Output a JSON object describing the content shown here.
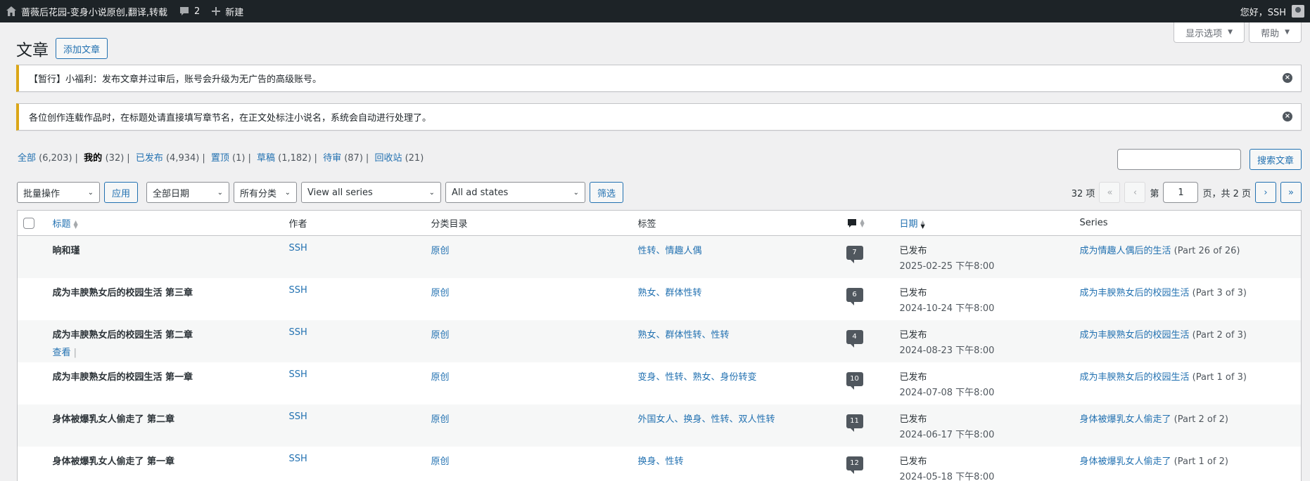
{
  "adminbar": {
    "site_title": "蔷薇后花园-变身小说原创,翻译,转载",
    "comments_count": "2",
    "new_label": "新建",
    "greeting": "您好，SSH"
  },
  "screen_meta": {
    "options_label": "显示选项",
    "help_label": "帮助"
  },
  "page": {
    "title": "文章",
    "add_new_label": "添加文章"
  },
  "notices": [
    "【暂行】小福利：发布文章并过审后，账号会升级为无广告的高级账号。",
    "各位创作连载作品时，在标题处请直接填写章节名，在正文处标注小说名，系统会自动进行处理了。"
  ],
  "views": [
    {
      "label": "全部",
      "count": "(6,203)"
    },
    {
      "label": "我的",
      "count": "(32)"
    },
    {
      "label": "已发布",
      "count": "(4,934)"
    },
    {
      "label": "置顶",
      "count": "(1)"
    },
    {
      "label": "草稿",
      "count": "(1,182)"
    },
    {
      "label": "待审",
      "count": "(87)"
    },
    {
      "label": "回收站",
      "count": "(21)"
    }
  ],
  "search": {
    "button_label": "搜索文章",
    "value": ""
  },
  "filters": {
    "bulk_action": "批量操作",
    "apply_label": "应用",
    "date": "全部日期",
    "category": "所有分类",
    "series": "View all series",
    "ad_state": "All ad states",
    "filter_label": "筛选"
  },
  "pagination": {
    "items": "32 项",
    "first": "«",
    "prev": "‹",
    "page_prefix": "第",
    "current": "1",
    "page_suffix": "页，共 2 页",
    "next": "›",
    "last": "»"
  },
  "columns": {
    "title": "标题",
    "author": "作者",
    "categories": "分类目录",
    "tags": "标签",
    "date": "日期",
    "series": "Series"
  },
  "rows": [
    {
      "title": "晌和瑾",
      "author": "SSH",
      "category": "原创",
      "tags": "性转、情趣人偶",
      "comments": "7",
      "status": "已发布",
      "date": "2025-02-25 下午8:00",
      "series_link": "成为情趣人偶后的生活",
      "series_part": "(Part 26 of 26)",
      "action": ""
    },
    {
      "title": "成为丰腴熟女后的校园生活 第三章",
      "author": "SSH",
      "category": "原创",
      "tags": "熟女、群体性转",
      "comments": "6",
      "status": "已发布",
      "date": "2024-10-24 下午8:00",
      "series_link": "成为丰腴熟女后的校园生活",
      "series_part": "(Part 3 of 3)",
      "action": ""
    },
    {
      "title": "成为丰腴熟女后的校园生活 第二章",
      "author": "SSH",
      "category": "原创",
      "tags": "熟女、群体性转、性转",
      "comments": "4",
      "status": "已发布",
      "date": "2024-08-23 下午8:00",
      "series_link": "成为丰腴熟女后的校园生活",
      "series_part": "(Part 2 of 3)",
      "action": "查看"
    },
    {
      "title": "成为丰腴熟女后的校园生活 第一章",
      "author": "SSH",
      "category": "原创",
      "tags": "变身、性转、熟女、身份转变",
      "comments": "10",
      "status": "已发布",
      "date": "2024-07-08 下午8:00",
      "series_link": "成为丰腴熟女后的校园生活",
      "series_part": "(Part 1 of 3)",
      "action": ""
    },
    {
      "title": "身体被爆乳女人偷走了 第二章",
      "author": "SSH",
      "category": "原创",
      "tags": "外国女人、换身、性转、双人性转",
      "comments": "11",
      "status": "已发布",
      "date": "2024-06-17 下午8:00",
      "series_link": "身体被爆乳女人偷走了",
      "series_part": "(Part 2 of 2)",
      "action": ""
    },
    {
      "title": "身体被爆乳女人偷走了 第一章",
      "author": "SSH",
      "category": "原创",
      "tags": "换身、性转",
      "comments": "12",
      "status": "已发布",
      "date": "2024-05-18 下午8:00",
      "series_link": "身体被爆乳女人偷走了",
      "series_part": "(Part 1 of 2)",
      "action": ""
    }
  ]
}
